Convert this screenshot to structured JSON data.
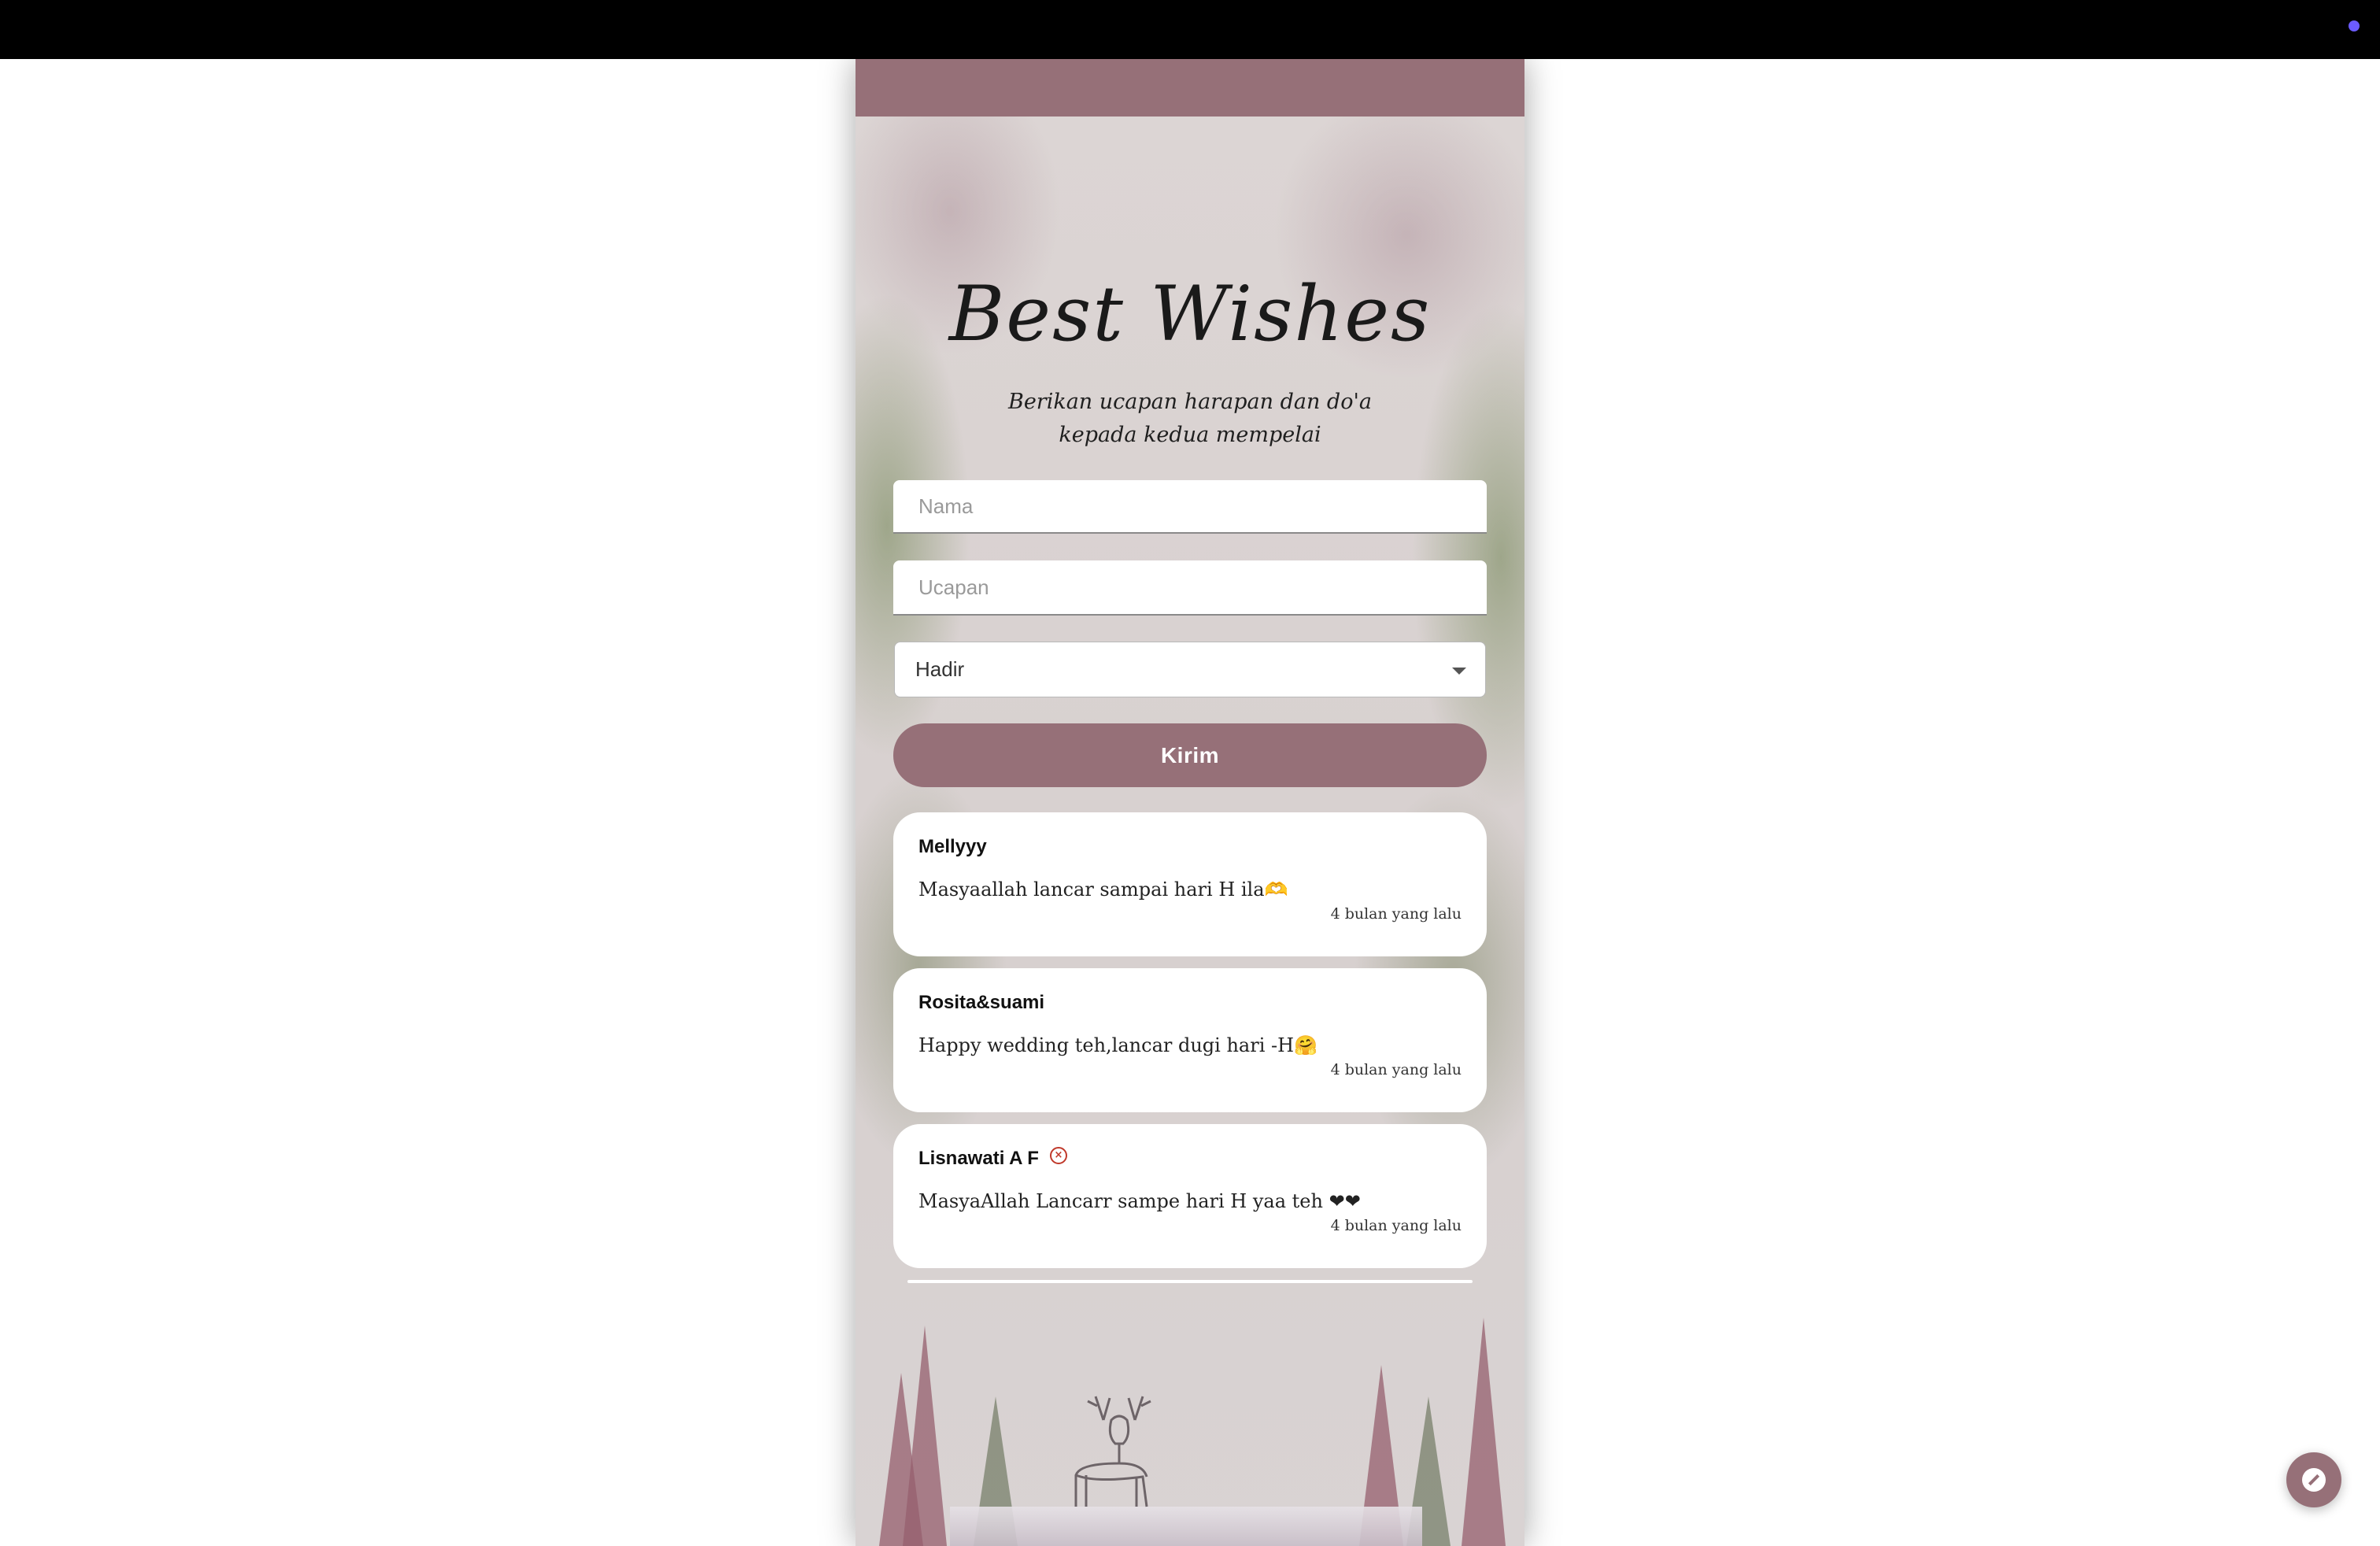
{
  "colors": {
    "accent": "#967078",
    "topbar": "#000000",
    "card": "#ffffff"
  },
  "section": {
    "title": "Best Wishes",
    "subtitle": "Berikan ucapan harapan dan do'a kepada kedua mempelai"
  },
  "form": {
    "name_placeholder": "Nama",
    "message_placeholder": "Ucapan",
    "attendance_value": "Hadir",
    "submit_label": "Kirim"
  },
  "wishes": [
    {
      "name": "Mellyyy",
      "message": "Masyaallah lancar sampai hari H ila🫶",
      "time": "4 bulan yang lalu",
      "icon": null
    },
    {
      "name": "Rosita&suami",
      "message": "Happy wedding teh,lancar dugi hari -H🤗",
      "time": "4 bulan yang lalu",
      "icon": null
    },
    {
      "name": "Lisnawati A F",
      "message": "MasyaAllah Lancarr sampe hari H yaa teh ❤❤",
      "time": "4 bulan yang lalu",
      "icon": "close-circle-icon"
    }
  ],
  "fab_icon": "music-disc-icon"
}
